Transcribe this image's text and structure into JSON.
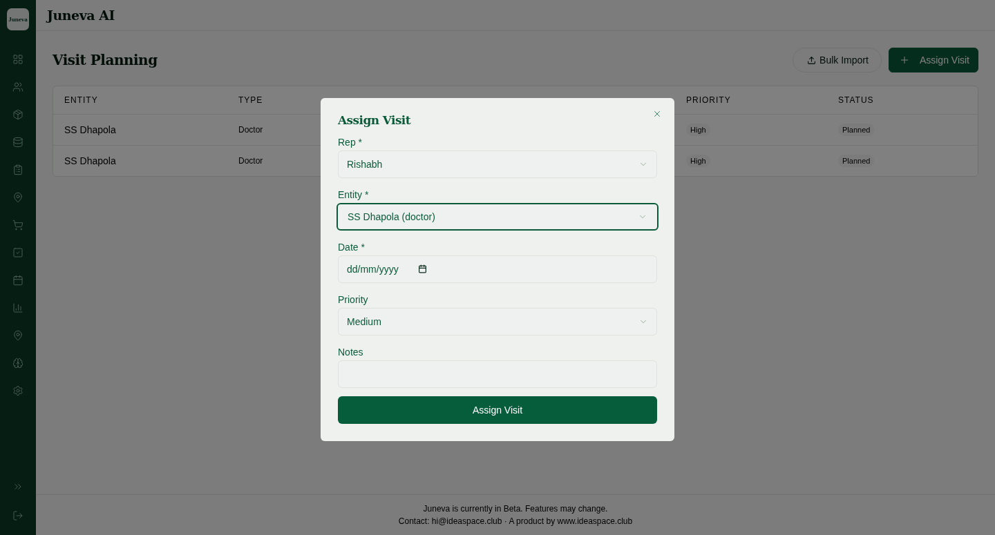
{
  "app": {
    "logo": "Juneva",
    "title": "Juneva AI"
  },
  "page": {
    "title": "Visit Planning",
    "actions": [
      {
        "kind": "secondary",
        "label": "Bulk Import"
      },
      {
        "kind": "primary",
        "label": "Assign Visit"
      }
    ]
  },
  "table": {
    "columns": [
      "ENTITY",
      "TYPE",
      "PRIORITY",
      "STATUS"
    ],
    "rows": [
      [
        "SS Dhapola",
        "Doctor",
        "High",
        "Planned"
      ],
      [
        "SS Dhapola",
        "Doctor",
        "High",
        "Planned"
      ]
    ]
  },
  "footer": {
    "lines": [
      "Juneva is currently in Beta. Features may change.",
      "Contact: hi@ideaspace.club · A product by www.ideaspace.club"
    ]
  },
  "dialog": {
    "title": "Assign Visit",
    "fields": [
      {
        "kind": "select",
        "label": "Rep *",
        "value": "Rishabh",
        "focused": false
      },
      {
        "kind": "select",
        "label": "Entity *",
        "value": "SS Dhapola (doctor)",
        "focused": true
      },
      {
        "kind": "date",
        "label": "Date *",
        "placeholder": "dd/mm/yyyy",
        "focused": false
      },
      {
        "kind": "select",
        "label": "Priority",
        "value": "Medium",
        "focused": false
      },
      {
        "kind": "text",
        "label": "Notes",
        "focused": false
      }
    ],
    "submit": "Assign Visit"
  }
}
